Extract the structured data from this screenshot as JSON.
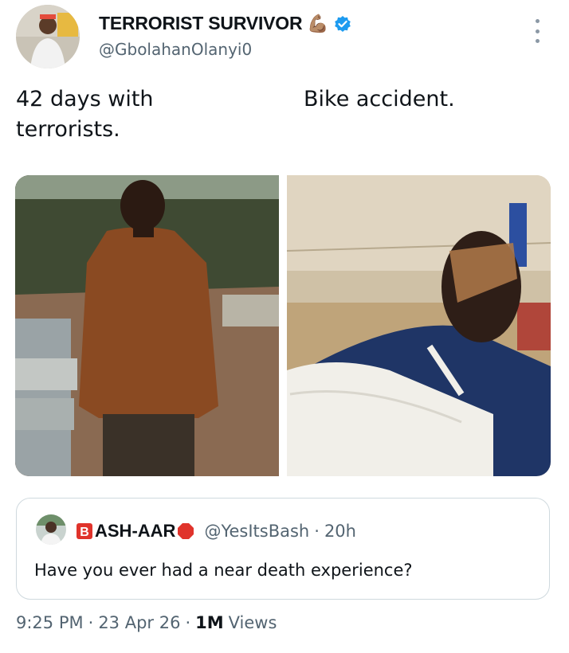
{
  "author": {
    "display_name": "TERRORIST SURVIVOR",
    "emoji": "💪🏽",
    "handle": "@GbolahanOlanyi0",
    "verified": true
  },
  "tweet": {
    "text_left": "42 days with terrorists.",
    "text_right": "Bike accident."
  },
  "media": [
    {
      "name": "photo-man-outdoors"
    },
    {
      "name": "photo-man-bandaged"
    }
  ],
  "quoted_tweet": {
    "b_icon": "🅱️",
    "display_name": "ASH-AAR",
    "stop_icon": "🛑",
    "handle": "@YesItsBash",
    "separator": "·",
    "time": "20h",
    "text": "Have you ever had a near death experience?"
  },
  "meta": {
    "time": "9:25 PM",
    "sep1": "·",
    "date": "23 Apr 26",
    "sep2": "·",
    "views_count": "1M",
    "views_label": "Views"
  },
  "colors": {
    "verified": "#1d9bf0",
    "secondary_text": "#536471",
    "border": "#cfd9de"
  }
}
